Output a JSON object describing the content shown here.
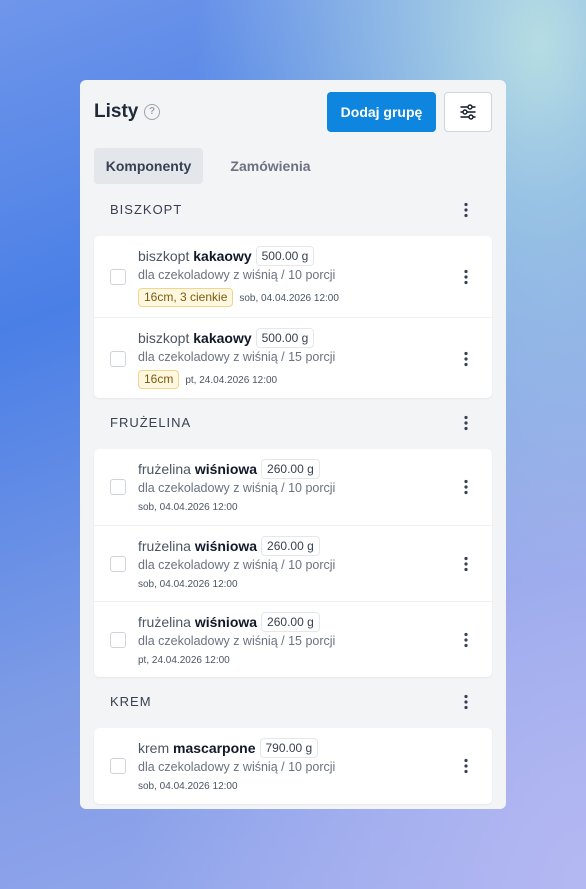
{
  "header": {
    "title": "Listy",
    "help_icon": "?",
    "add_group_label": "Dodaj grupę",
    "filter_icon": "sliders-icon"
  },
  "tabs": [
    {
      "label": "Komponenty",
      "active": true
    },
    {
      "label": "Zamówienia",
      "active": false
    }
  ],
  "sections": [
    {
      "title": "BISZKOPT",
      "items": [
        {
          "name_prefix": "biszkopt",
          "name_bold": "kakaowy",
          "weight": "500.00 g",
          "subtitle": "dla czekoladowy z wiśnią / 10 porcji",
          "tag": "16cm, 3 cienkie",
          "date": "sob, 04.04.2026 12:00"
        },
        {
          "name_prefix": "biszkopt",
          "name_bold": "kakaowy",
          "weight": "500.00 g",
          "subtitle": "dla czekoladowy z wiśnią / 15 porcji",
          "tag": "16cm",
          "date": "pt, 24.04.2026 12:00"
        }
      ]
    },
    {
      "title": "FRUŻELINA",
      "items": [
        {
          "name_prefix": "frużelina",
          "name_bold": "wiśniowa",
          "weight": "260.00 g",
          "subtitle": "dla czekoladowy z wiśnią / 10 porcji",
          "date": "sob, 04.04.2026 12:00"
        },
        {
          "name_prefix": "frużelina",
          "name_bold": "wiśniowa",
          "weight": "260.00 g",
          "subtitle": "dla czekoladowy z wiśnią / 10 porcji",
          "date": "sob, 04.04.2026 12:00"
        },
        {
          "name_prefix": "frużelina",
          "name_bold": "wiśniowa",
          "weight": "260.00 g",
          "subtitle": "dla czekoladowy z wiśnią / 15 porcji",
          "date": "pt, 24.04.2026 12:00"
        }
      ]
    },
    {
      "title": "KREM",
      "items": [
        {
          "name_prefix": "krem",
          "name_bold": "mascarpone",
          "weight": "790.00 g",
          "subtitle": "dla czekoladowy z wiśnią / 10 porcji",
          "date": "sob, 04.04.2026 12:00"
        }
      ]
    }
  ],
  "colors": {
    "primary": "#0e86e0",
    "tag_bg": "#fff7e0",
    "tag_border": "#f2d58a"
  }
}
